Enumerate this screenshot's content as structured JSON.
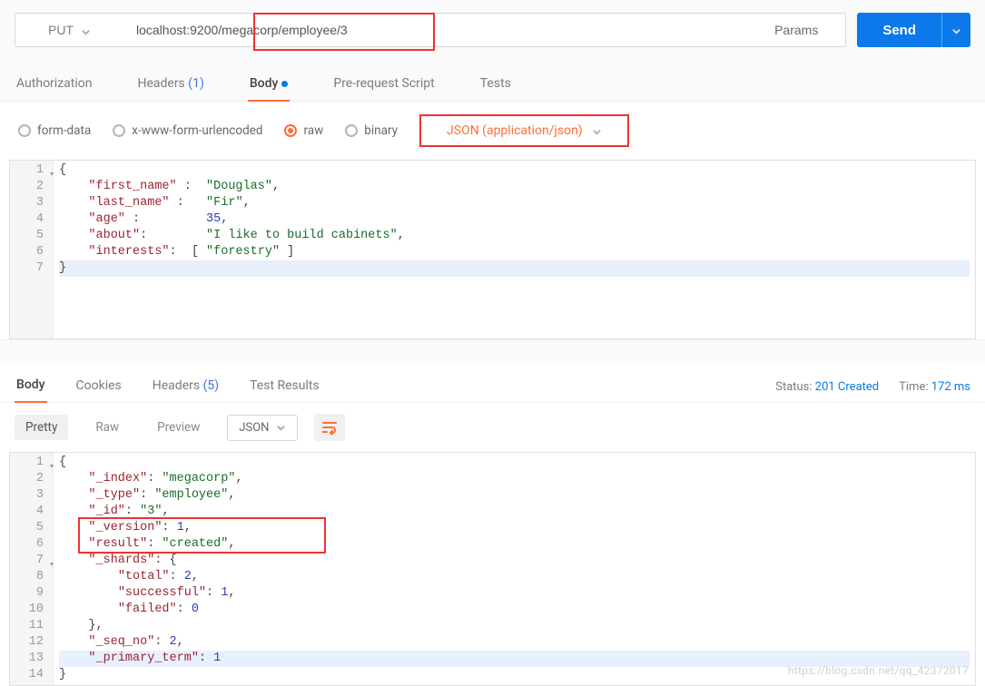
{
  "request": {
    "method": "PUT",
    "url": "localhost:9200/megacorp/employee/3",
    "params_label": "Params",
    "send_label": "Send"
  },
  "tabs_top": {
    "authorization": "Authorization",
    "headers": "Headers",
    "headers_count": "(1)",
    "body": "Body",
    "pre": "Pre-request Script",
    "tests": "Tests"
  },
  "body_types": {
    "form": "form-data",
    "urlencoded": "x-www-form-urlencoded",
    "raw": "raw",
    "binary": "binary",
    "json_select": "JSON (application/json)"
  },
  "request_body_lines": [
    {
      "num": "1",
      "indent": "",
      "tokens": [
        {
          "t": "{",
          "c": "p"
        }
      ]
    },
    {
      "num": "2",
      "indent": "    ",
      "tokens": [
        {
          "t": "\"first_name\"",
          "c": "k"
        },
        {
          "t": " :  ",
          "c": "p"
        },
        {
          "t": "\"Douglas\"",
          "c": "s"
        },
        {
          "t": ",",
          "c": "p"
        }
      ]
    },
    {
      "num": "3",
      "indent": "    ",
      "tokens": [
        {
          "t": "\"last_name\"",
          "c": "k"
        },
        {
          "t": " :   ",
          "c": "p"
        },
        {
          "t": "\"Fir\"",
          "c": "s"
        },
        {
          "t": ",",
          "c": "p"
        }
      ]
    },
    {
      "num": "4",
      "indent": "    ",
      "tokens": [
        {
          "t": "\"age\"",
          "c": "k"
        },
        {
          "t": " :         ",
          "c": "p"
        },
        {
          "t": "35",
          "c": "n"
        },
        {
          "t": ",",
          "c": "p"
        }
      ]
    },
    {
      "num": "5",
      "indent": "    ",
      "tokens": [
        {
          "t": "\"about\"",
          "c": "k"
        },
        {
          "t": ":        ",
          "c": "p"
        },
        {
          "t": "\"I like to build cabinets\"",
          "c": "s"
        },
        {
          "t": ",",
          "c": "p"
        }
      ]
    },
    {
      "num": "6",
      "indent": "    ",
      "tokens": [
        {
          "t": "\"interests\"",
          "c": "k"
        },
        {
          "t": ":  [ ",
          "c": "p"
        },
        {
          "t": "\"forestry\"",
          "c": "s"
        },
        {
          "t": " ]",
          "c": "p"
        }
      ]
    },
    {
      "num": "7",
      "indent": "",
      "tokens": [
        {
          "t": "}",
          "c": "p"
        }
      ],
      "hl": true
    }
  ],
  "response_tabs": {
    "body": "Body",
    "cookies": "Cookies",
    "headers": "Headers",
    "headers_count": "(5)",
    "tests": "Test Results"
  },
  "response_meta": {
    "status_label": "Status:",
    "status_val": "201 Created",
    "time_label": "Time:",
    "time_val": "172 ms"
  },
  "view_modes": {
    "pretty": "Pretty",
    "raw": "Raw",
    "preview": "Preview",
    "json": "JSON"
  },
  "response_body_lines": [
    {
      "num": "1",
      "indent": "",
      "tokens": [
        {
          "t": "{",
          "c": "p"
        }
      ]
    },
    {
      "num": "2",
      "indent": "    ",
      "tokens": [
        {
          "t": "\"_index\"",
          "c": "k"
        },
        {
          "t": ": ",
          "c": "p"
        },
        {
          "t": "\"megacorp\"",
          "c": "s"
        },
        {
          "t": ",",
          "c": "p"
        }
      ]
    },
    {
      "num": "3",
      "indent": "    ",
      "tokens": [
        {
          "t": "\"_type\"",
          "c": "k"
        },
        {
          "t": ": ",
          "c": "p"
        },
        {
          "t": "\"employee\"",
          "c": "s"
        },
        {
          "t": ",",
          "c": "p"
        }
      ]
    },
    {
      "num": "4",
      "indent": "    ",
      "tokens": [
        {
          "t": "\"_id\"",
          "c": "k"
        },
        {
          "t": ": ",
          "c": "p"
        },
        {
          "t": "\"3\"",
          "c": "s"
        },
        {
          "t": ",",
          "c": "p"
        }
      ]
    },
    {
      "num": "5",
      "indent": "    ",
      "tokens": [
        {
          "t": "\"_version\"",
          "c": "k"
        },
        {
          "t": ": ",
          "c": "p"
        },
        {
          "t": "1",
          "c": "n"
        },
        {
          "t": ",",
          "c": "p"
        }
      ]
    },
    {
      "num": "6",
      "indent": "    ",
      "tokens": [
        {
          "t": "\"result\"",
          "c": "k"
        },
        {
          "t": ": ",
          "c": "p"
        },
        {
          "t": "\"created\"",
          "c": "s"
        },
        {
          "t": ",",
          "c": "p"
        }
      ]
    },
    {
      "num": "7",
      "indent": "    ",
      "tokens": [
        {
          "t": "\"_shards\"",
          "c": "k"
        },
        {
          "t": ": {",
          "c": "p"
        }
      ]
    },
    {
      "num": "8",
      "indent": "        ",
      "tokens": [
        {
          "t": "\"total\"",
          "c": "k"
        },
        {
          "t": ": ",
          "c": "p"
        },
        {
          "t": "2",
          "c": "n"
        },
        {
          "t": ",",
          "c": "p"
        }
      ]
    },
    {
      "num": "9",
      "indent": "        ",
      "tokens": [
        {
          "t": "\"successful\"",
          "c": "k"
        },
        {
          "t": ": ",
          "c": "p"
        },
        {
          "t": "1",
          "c": "n"
        },
        {
          "t": ",",
          "c": "p"
        }
      ]
    },
    {
      "num": "10",
      "indent": "        ",
      "tokens": [
        {
          "t": "\"failed\"",
          "c": "k"
        },
        {
          "t": ": ",
          "c": "p"
        },
        {
          "t": "0",
          "c": "n"
        }
      ]
    },
    {
      "num": "11",
      "indent": "    ",
      "tokens": [
        {
          "t": "},",
          "c": "p"
        }
      ]
    },
    {
      "num": "12",
      "indent": "    ",
      "tokens": [
        {
          "t": "\"_seq_no\"",
          "c": "k"
        },
        {
          "t": ": ",
          "c": "p"
        },
        {
          "t": "2",
          "c": "n"
        },
        {
          "t": ",",
          "c": "p"
        }
      ]
    },
    {
      "num": "13",
      "indent": "    ",
      "tokens": [
        {
          "t": "\"_primary_term\"",
          "c": "k"
        },
        {
          "t": ": ",
          "c": "p"
        },
        {
          "t": "1",
          "c": "n"
        }
      ],
      "hl": true
    },
    {
      "num": "14",
      "indent": "",
      "tokens": [
        {
          "t": "}",
          "c": "p"
        }
      ]
    }
  ],
  "watermark": "https://blog.csdn.net/qq_42372017"
}
